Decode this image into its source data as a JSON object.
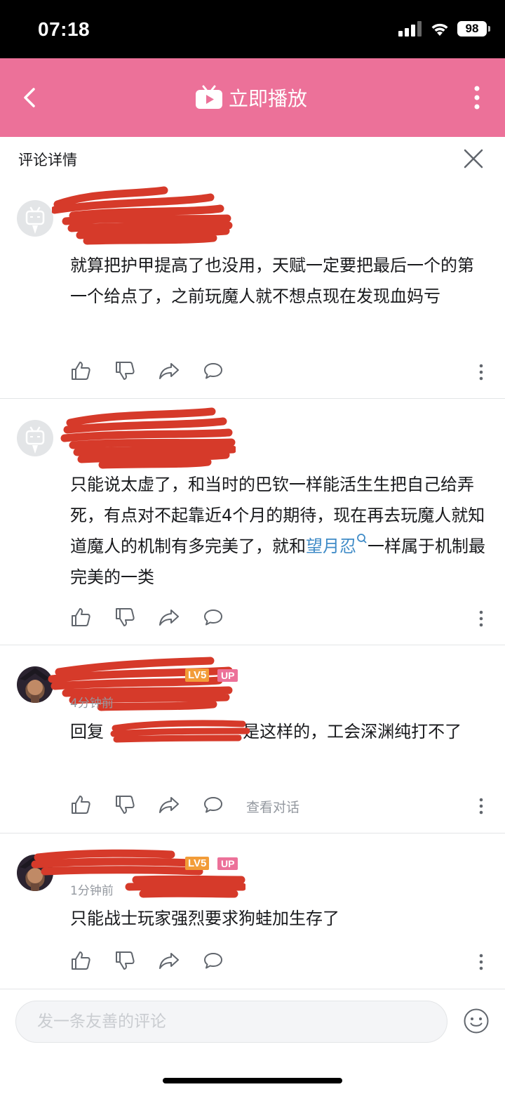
{
  "status_bar": {
    "time": "07:18",
    "battery": "98"
  },
  "topbar": {
    "play_label": "立即播放"
  },
  "detail": {
    "title": "评论详情"
  },
  "comments": [
    {
      "text": "就算把护甲提高了也没用，天赋一定要把最后一个的第一个给点了，之前玩魔人就不想点现在发现血妈亏"
    },
    {
      "text_before_link": "只能说太虚了，和当时的巴钦一样能活生生把自己给弄死，有点对不起靠近4个月的期待，现在再去玩魔人就知道魔人的机制有多完美了，就和",
      "link": "望月忍",
      "text_after_link": "一样属于机制最完美的一类"
    },
    {
      "level": "LV5",
      "up_badge": "UP",
      "time": "4分钟前",
      "reply_prefix": "回复",
      "text": ":是这样的，工会深渊纯打不了",
      "view_conversation": "查看对话"
    },
    {
      "level": "LV5",
      "up_badge": "UP",
      "time": "1分钟前",
      "text": "只能战士玩家强烈要求狗蛙加生存了"
    }
  ],
  "input": {
    "placeholder": "发一条友善的评论"
  },
  "colors": {
    "brand_pink": "#ec7199",
    "link_blue": "#3f8bc7",
    "redaction_red": "#d63a2a"
  }
}
